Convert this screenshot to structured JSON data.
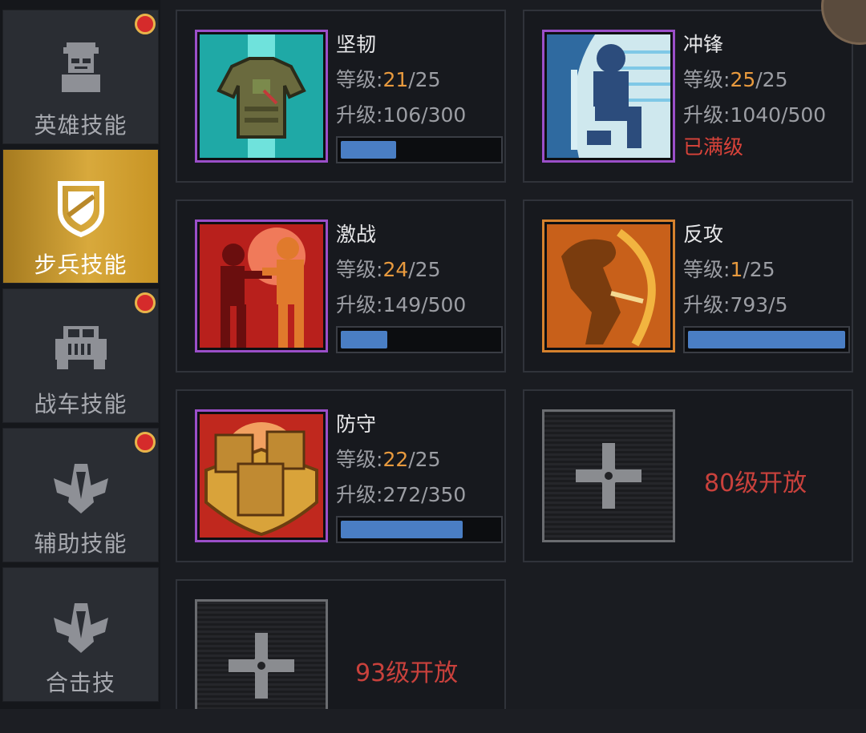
{
  "sidebar": {
    "tabs": [
      {
        "label": "英雄技能",
        "icon": "soldier-icon",
        "badge": true
      },
      {
        "label": "步兵技能",
        "icon": "shield-icon",
        "badge": false,
        "active": true
      },
      {
        "label": "战车技能",
        "icon": "jeep-icon",
        "badge": true
      },
      {
        "label": "辅助技能",
        "icon": "wings-emblem-icon",
        "badge": true
      },
      {
        "label": "合击技",
        "icon": "wings-emblem-icon",
        "badge": false
      }
    ]
  },
  "labels": {
    "level_prefix": "等级:",
    "upgrade_prefix": "升级:",
    "max_level": "已满级"
  },
  "skills": [
    {
      "name": "坚韧",
      "level": "21",
      "level_max": "/25",
      "upgrade": "106/300",
      "progress": 0.353,
      "icon": "armor-vest-icon"
    },
    {
      "name": "冲锋",
      "level": "25",
      "level_max": "/25",
      "upgrade": "1040/500",
      "maxed": true,
      "icon": "charge-soldier-icon"
    },
    {
      "name": "激战",
      "level": "24",
      "level_max": "/25",
      "upgrade": "149/500",
      "progress": 0.298,
      "icon": "combat-figures-icon"
    },
    {
      "name": "反攻",
      "level": "1",
      "level_max": "/25",
      "upgrade": "793/5",
      "progress": 1.0,
      "icon": "counterattack-figure-icon"
    },
    {
      "name": "防守",
      "level": "22",
      "level_max": "/25",
      "upgrade": "272/350",
      "progress": 0.777,
      "icon": "defense-crates-icon"
    }
  ],
  "locked": [
    {
      "text": "80级开放",
      "icon": "cross-plus-icon"
    },
    {
      "text": "93级开放",
      "icon": "cross-plus-icon"
    }
  ],
  "colors": {
    "accent_gold": "#d8a93c",
    "level_orange": "#e89a3e",
    "maxed_red": "#d9433a",
    "bar_blue": "#4a7ec4",
    "frame_purple": "#9b4fc9",
    "frame_orange": "#d6822e",
    "badge_red": "#d52b2b"
  }
}
